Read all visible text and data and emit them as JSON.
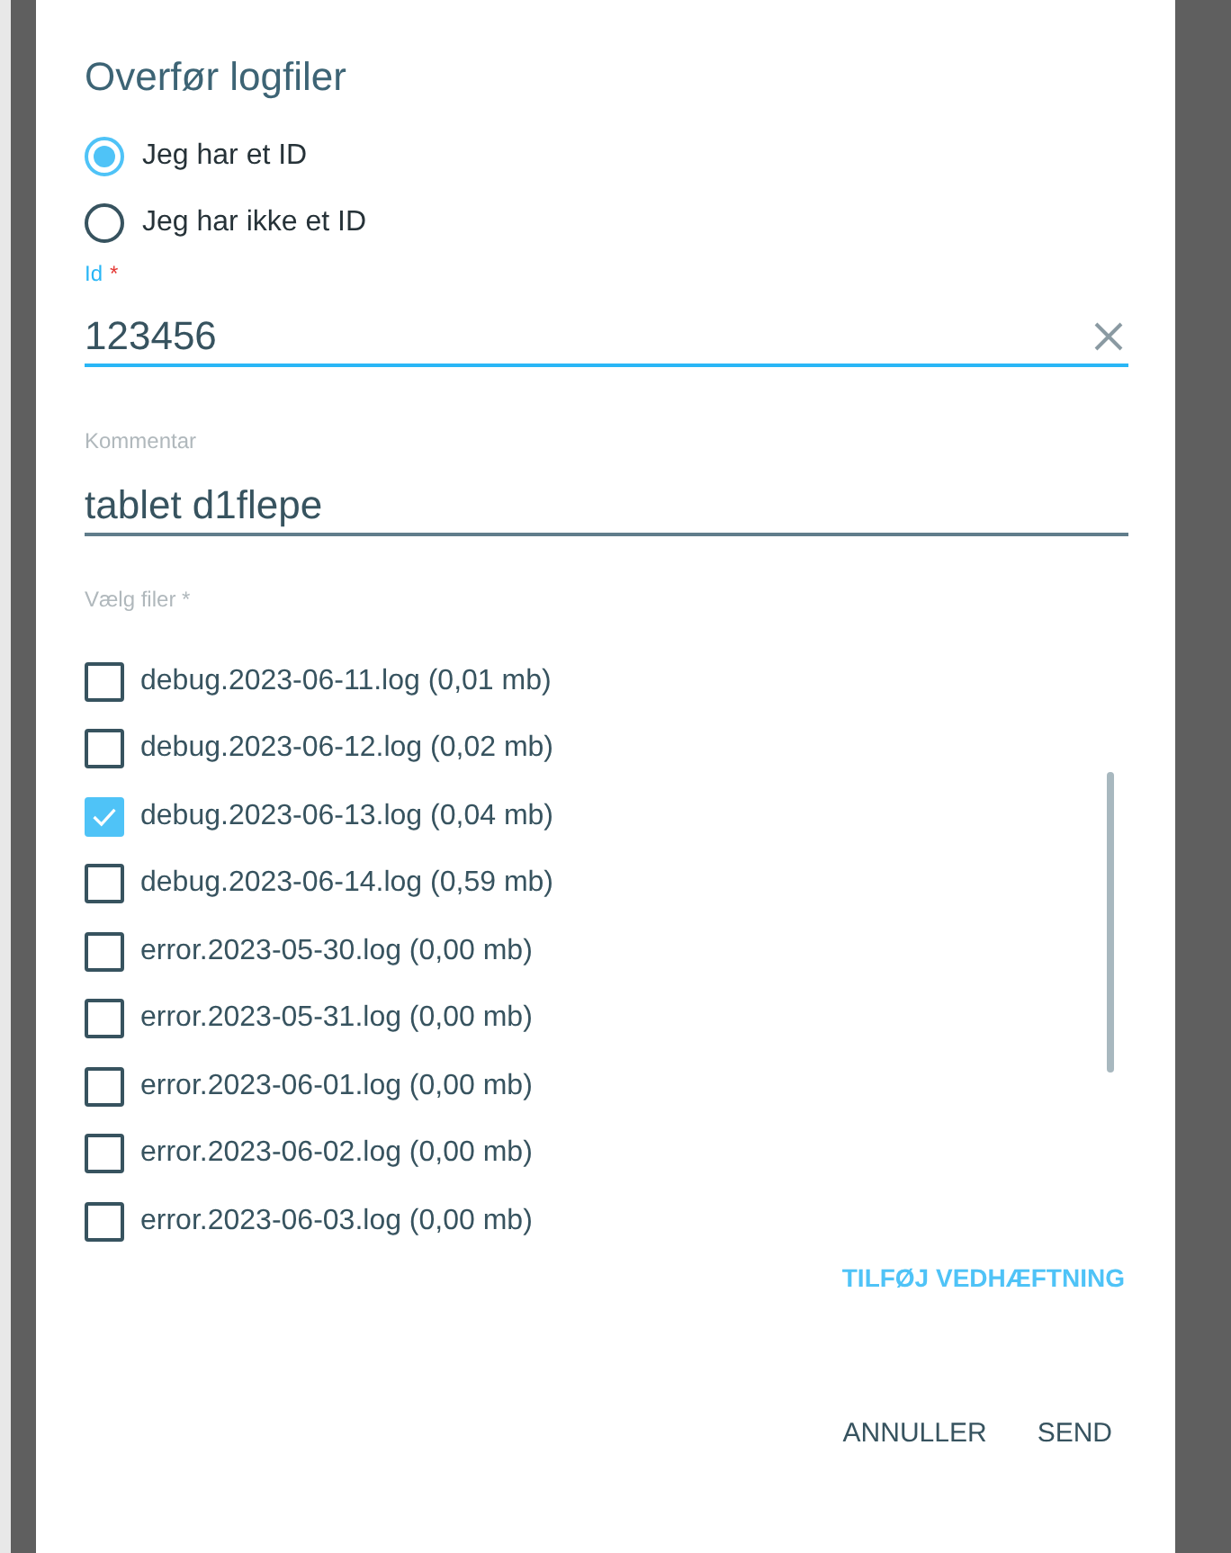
{
  "dialog": {
    "title": "Overfør logfiler"
  },
  "id_options": [
    {
      "label": "Jeg har et ID",
      "selected": true
    },
    {
      "label": "Jeg har ikke et ID",
      "selected": false
    }
  ],
  "id_field": {
    "label": "Id",
    "required_mark": "*",
    "value": "123456",
    "focused": true
  },
  "comment_field": {
    "label": "Kommentar",
    "value": "tablet d1flepe",
    "focused": false
  },
  "files": {
    "label": "Vælg filer *",
    "items": [
      {
        "label": "debug.2023-06-11.log (0,01 mb)",
        "checked": false
      },
      {
        "label": "debug.2023-06-12.log (0,02 mb)",
        "checked": false
      },
      {
        "label": "debug.2023-06-13.log (0,04 mb)",
        "checked": true
      },
      {
        "label": "debug.2023-06-14.log (0,59 mb)",
        "checked": false
      },
      {
        "label": "error.2023-05-30.log (0,00 mb)",
        "checked": false
      },
      {
        "label": "error.2023-05-31.log (0,00 mb)",
        "checked": false
      },
      {
        "label": "error.2023-06-01.log (0,00 mb)",
        "checked": false
      },
      {
        "label": "error.2023-06-02.log (0,00 mb)",
        "checked": false
      },
      {
        "label": "error.2023-06-03.log (0,00 mb)",
        "checked": false
      }
    ]
  },
  "attach_button": "TILFØJ VEDHÆFTNING",
  "buttons": [
    "ANNULLER",
    "SEND"
  ]
}
